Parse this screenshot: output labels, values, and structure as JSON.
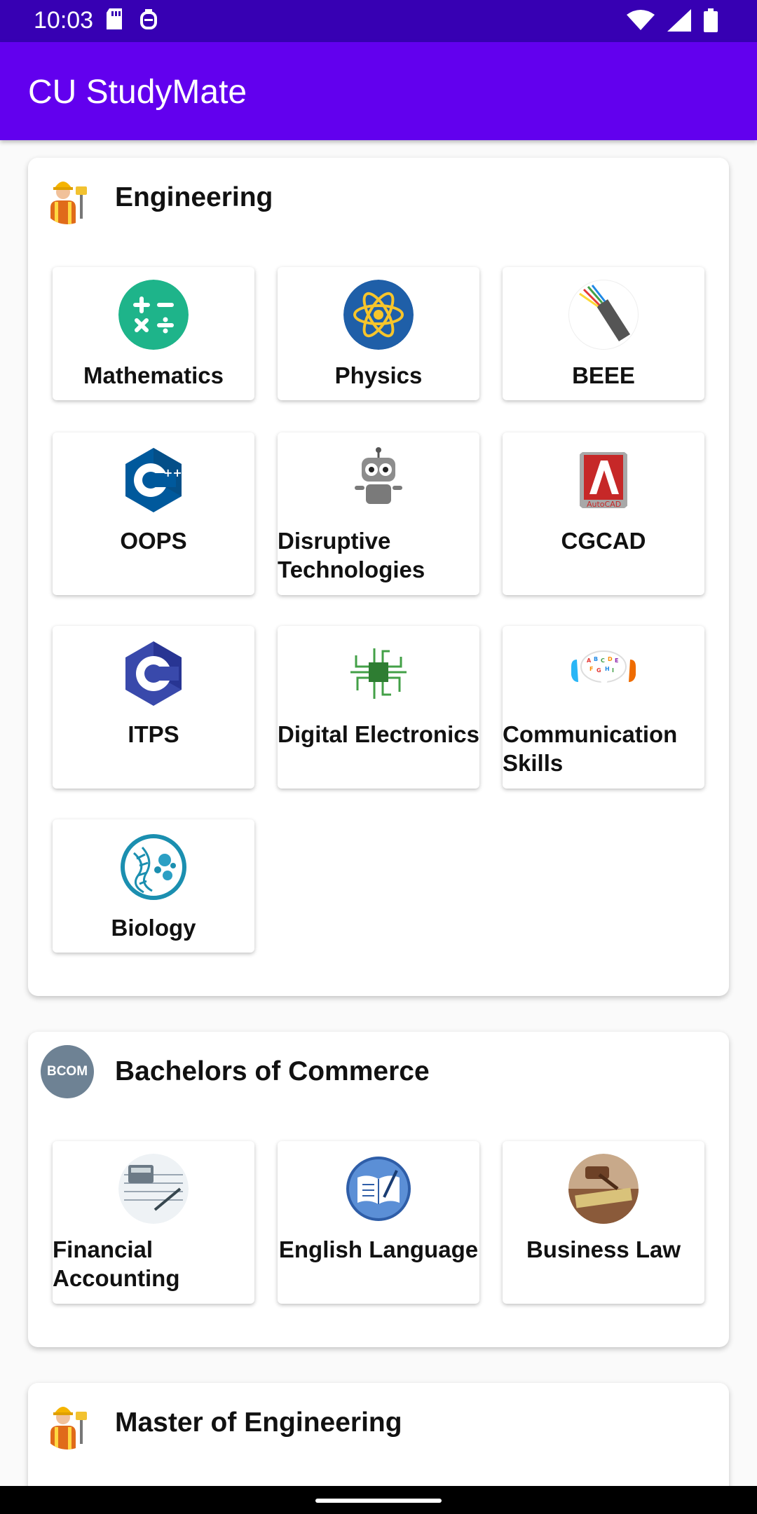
{
  "status_bar": {
    "time": "10:03",
    "left_icons": [
      "sd-card-icon",
      "notification-icon"
    ],
    "right_icons": [
      "wifi-icon",
      "signal-icon",
      "battery-icon"
    ]
  },
  "app_bar": {
    "title": "CU StudyMate",
    "color": "#6200ee",
    "status_color": "#3700b3"
  },
  "sections": [
    {
      "title": "Engineering",
      "avatar": "engineer-avatar-icon",
      "subjects": [
        {
          "label": "Mathematics",
          "icon": "math-symbols-icon"
        },
        {
          "label": "Physics",
          "icon": "atom-icon"
        },
        {
          "label": "BEEE",
          "icon": "cable-icon"
        },
        {
          "label": "OOPS",
          "icon": "cpp-logo-icon"
        },
        {
          "label": "Disruptive Technologies",
          "icon": "robot-icon"
        },
        {
          "label": "CGCAD",
          "icon": "autocad-icon"
        },
        {
          "label": "ITPS",
          "icon": "c-logo-icon"
        },
        {
          "label": "Digital Electronics",
          "icon": "circuit-icon"
        },
        {
          "label": "Communication Skills",
          "icon": "speech-bubble-icon"
        },
        {
          "label": "Biology",
          "icon": "dna-icon"
        }
      ]
    },
    {
      "title": "Bachelors of Commerce",
      "avatar": "bcom-avatar-icon",
      "avatar_text": "BCOM",
      "subjects": [
        {
          "label": "Financial Accounting",
          "icon": "calculator-icon"
        },
        {
          "label": "English Language",
          "icon": "book-icon"
        },
        {
          "label": "Business Law",
          "icon": "gavel-icon"
        }
      ]
    },
    {
      "title": "Master of Engineering",
      "avatar": "engineer-avatar-icon",
      "subjects": []
    }
  ]
}
